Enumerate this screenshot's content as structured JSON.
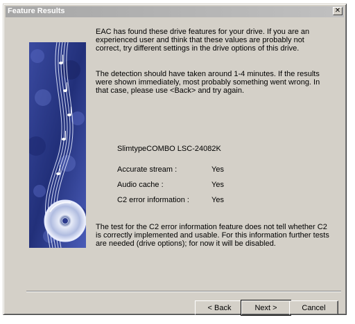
{
  "window": {
    "title": "Feature Results",
    "close_glyph": "✕"
  },
  "content": {
    "intro": "EAC has found these drive features for your drive. If you are an experienced user and think that these values are probably not correct, try different settings in the drive options of this drive.",
    "detection": "The detection should have taken around 1-4 minutes. If the results were shown immediately, most probably something went wrong. In that case, please use <Back> and try again.",
    "drive_name": "SlimtypeCOMBO LSC-24082K",
    "features": [
      {
        "label": "Accurate stream :",
        "value": "Yes"
      },
      {
        "label": "Audio cache :",
        "value": "Yes"
      },
      {
        "label": "C2 error information :",
        "value": "Yes"
      }
    ],
    "c2_note": "The test for the C2 error information feature does not tell whether C2 is correctly implemented and usable. For this information further tests are needed (drive options); for now it will be disabled."
  },
  "buttons": {
    "back": "< Back",
    "next": "Next >",
    "cancel": "Cancel"
  },
  "banner": {
    "icon": "music-cd-illustration",
    "colors": {
      "base": "#2b3a8c",
      "light": "#8fa0e0",
      "highlight": "#e6ecff"
    }
  }
}
